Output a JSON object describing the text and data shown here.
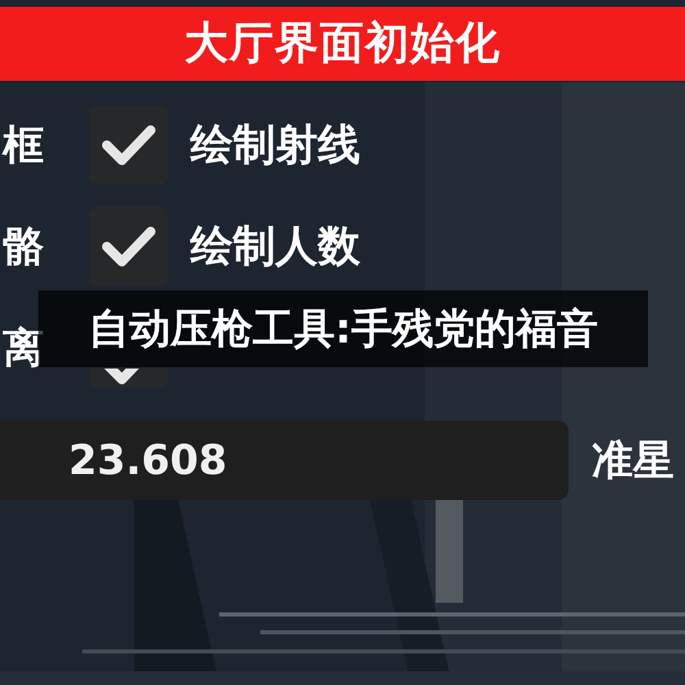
{
  "header": {
    "title": "大厅界面初始化"
  },
  "rows": [
    {
      "left_label": "框",
      "checked": true,
      "label": "绘制射线"
    },
    {
      "left_label": "骼",
      "checked": true,
      "label": "绘制人数"
    },
    {
      "left_label": "离",
      "checked": true
    }
  ],
  "value_field": {
    "value": "23.608",
    "side_label": "准星"
  },
  "caption": "自动压枪工具:手残党的福音"
}
